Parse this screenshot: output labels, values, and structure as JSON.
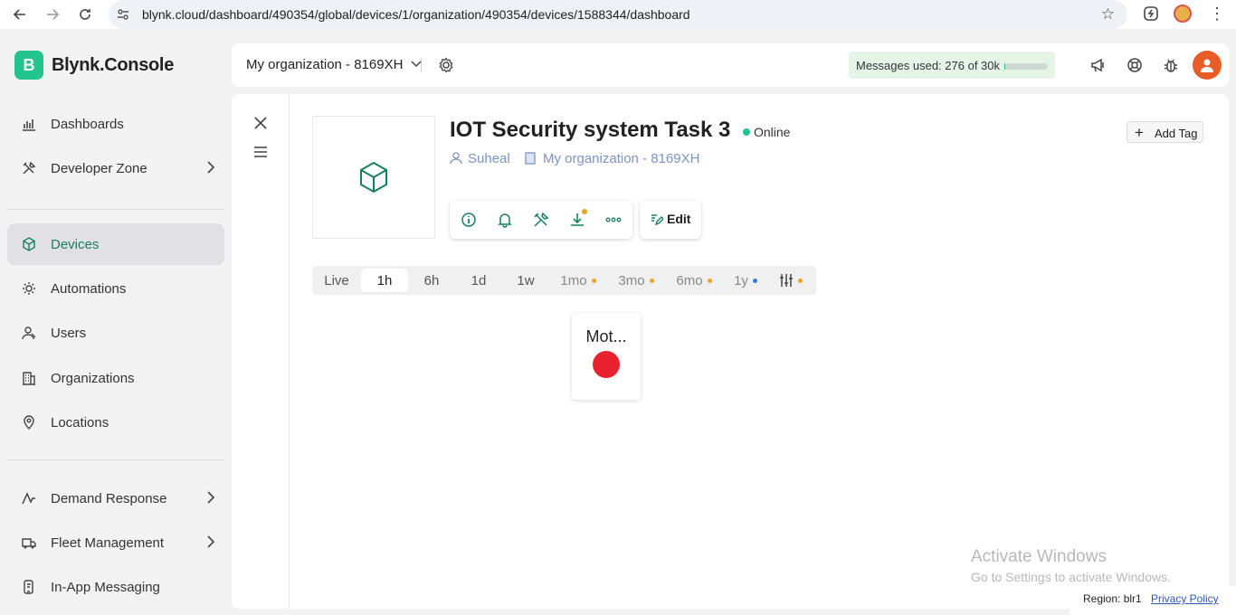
{
  "browser": {
    "url": "blynk.cloud/dashboard/490354/global/devices/1/organization/490354/devices/1588344/dashboard"
  },
  "sidebar": {
    "brand": "Blynk.Console",
    "logo_letter": "B",
    "items": [
      {
        "label": "Dashboards",
        "icon": "bar-chart-icon"
      },
      {
        "label": "Developer Zone",
        "icon": "tools-icon",
        "has_chevron": true
      },
      {
        "label": "Devices",
        "icon": "cube-icon",
        "active": true
      },
      {
        "label": "Automations",
        "icon": "automation-icon"
      },
      {
        "label": "Users",
        "icon": "users-icon"
      },
      {
        "label": "Organizations",
        "icon": "building-icon"
      },
      {
        "label": "Locations",
        "icon": "location-pin-icon"
      },
      {
        "label": "Demand Response",
        "icon": "pulse-icon",
        "has_chevron": true
      },
      {
        "label": "Fleet Management",
        "icon": "truck-icon",
        "has_chevron": true
      },
      {
        "label": "In-App Messaging",
        "icon": "phone-message-icon"
      }
    ]
  },
  "header": {
    "org_name": "My organization - 8169XH",
    "messages_label": "Messages used:",
    "messages_value": "276 of 30k",
    "messages_used_fraction": 0.0092
  },
  "device": {
    "title": "IOT Security system Task 3",
    "status": "Online",
    "owner": "Suheal",
    "organization": "My organization - 8169XH",
    "edit_label": "Edit",
    "add_tag_label": "Add Tag"
  },
  "time_ranges": [
    {
      "label": "Live"
    },
    {
      "label": "1h",
      "active": true
    },
    {
      "label": "6h"
    },
    {
      "label": "1d"
    },
    {
      "label": "1w"
    },
    {
      "label": "1mo",
      "dot": "#f0a020"
    },
    {
      "label": "3mo",
      "dot": "#f0a020"
    },
    {
      "label": "6mo",
      "dot": "#f0a020"
    },
    {
      "label": "1y",
      "dot": "#2b7de9"
    }
  ],
  "widget": {
    "title": "Mot...",
    "led_color": "#e8232f"
  },
  "footer": {
    "activate_title": "Activate Windows",
    "activate_sub": "Go to Settings to activate Windows.",
    "region": "Region: blr1",
    "privacy": "Privacy Policy"
  },
  "colors": {
    "brand_green": "#23c48e",
    "active_text": "#16805c",
    "link_blue": "#7b94c4"
  }
}
